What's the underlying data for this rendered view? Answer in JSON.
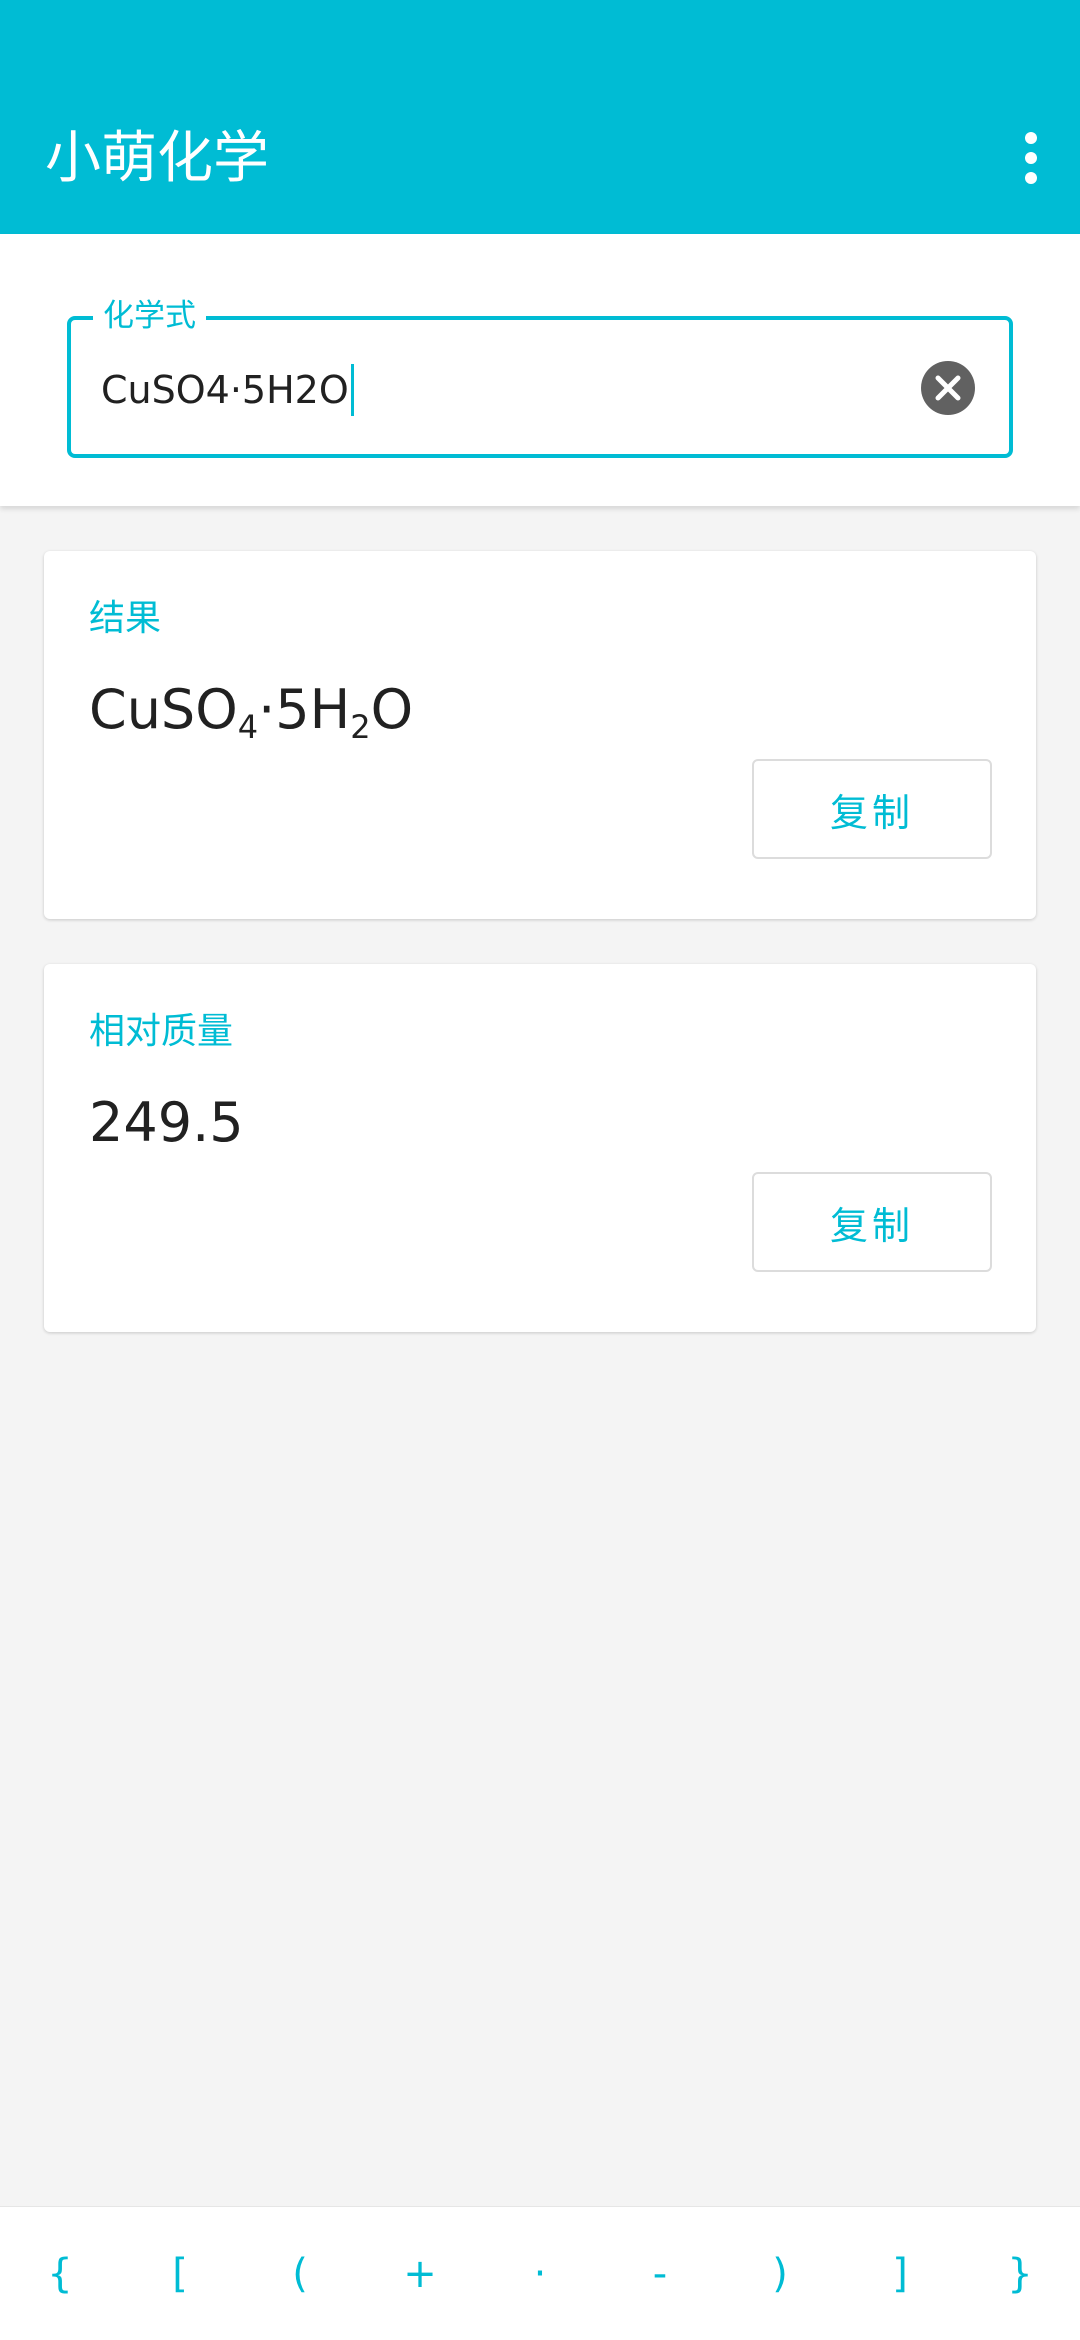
{
  "app": {
    "title": "小萌化学",
    "colors": {
      "primary": "#00bcd4",
      "clear_icon": "#616161",
      "background": "#f4f4f4"
    },
    "menu_icon": "more-vert-icon"
  },
  "input": {
    "label": "化学式",
    "value": "CuSO4·5H2O",
    "clear_icon": "clear-circle-icon"
  },
  "result_card": {
    "label": "结果",
    "formula": {
      "part1": "CuSO",
      "sub1": "4",
      "part2": "·5H",
      "sub2": "2",
      "part3": "O"
    },
    "copy_label": "复制"
  },
  "mass_card": {
    "label": "相对质量",
    "value": "249.5",
    "copy_label": "复制"
  },
  "keyboard": {
    "keys": [
      "{",
      "[",
      "(",
      "+",
      "·",
      "-",
      ")",
      "]",
      "}"
    ]
  }
}
